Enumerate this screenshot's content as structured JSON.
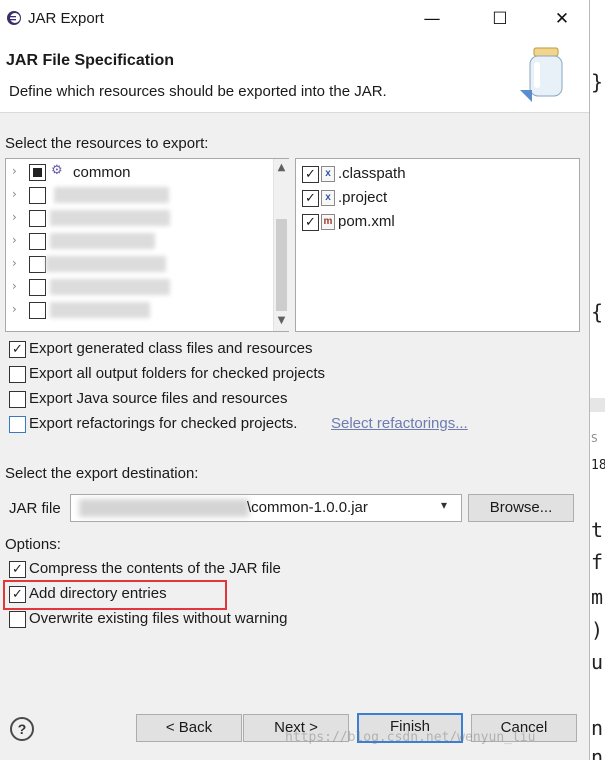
{
  "window": {
    "title": "JAR Export",
    "minimize_glyph": "—",
    "maximize_glyph": "☐",
    "close_glyph": "✕"
  },
  "header": {
    "title": "JAR File Specification",
    "description": "Define which resources should be exported into the JAR."
  },
  "resources": {
    "label": "Select the resources to export:",
    "tree_items": [
      {
        "label": "common",
        "checked": "partial"
      },
      {
        "label": "",
        "checked": "none"
      },
      {
        "label": "",
        "checked": "none"
      },
      {
        "label": "",
        "checked": "none"
      },
      {
        "label": "",
        "checked": "none"
      },
      {
        "label": "",
        "checked": "none"
      },
      {
        "label": "",
        "checked": "none"
      }
    ],
    "files": [
      {
        "label": ".classpath",
        "checked": true,
        "icon": "x"
      },
      {
        "label": ".project",
        "checked": true,
        "icon": "x"
      },
      {
        "label": "pom.xml",
        "checked": true,
        "icon": "m"
      }
    ]
  },
  "export_options": {
    "generated_class_files": "Export generated class files and resources",
    "output_folders": "Export all output folders for checked projects",
    "java_source": "Export Java source files and resources",
    "refactorings": "Export refactorings for checked projects.",
    "select_refactorings": "Select refactorings..."
  },
  "destination": {
    "label": "Select the export destination:",
    "jar_file_label": "JAR file",
    "jar_file_value": "\\common-1.0.0.jar",
    "browse": "Browse..."
  },
  "options": {
    "label": "Options:",
    "compress": "Compress the contents of the JAR file",
    "directory_entries": "Add directory entries",
    "overwrite": "Overwrite existing files without warning"
  },
  "buttons": {
    "help": "?",
    "back": "< Back",
    "next": "Next >",
    "finish": "Finish",
    "cancel": "Cancel"
  },
  "watermark": "https://blog.csdn.net/wenyun_liu",
  "colors": {
    "highlight": "#e0373b",
    "default_button_border": "#3c7fd0",
    "link": "#6d7bb0"
  }
}
